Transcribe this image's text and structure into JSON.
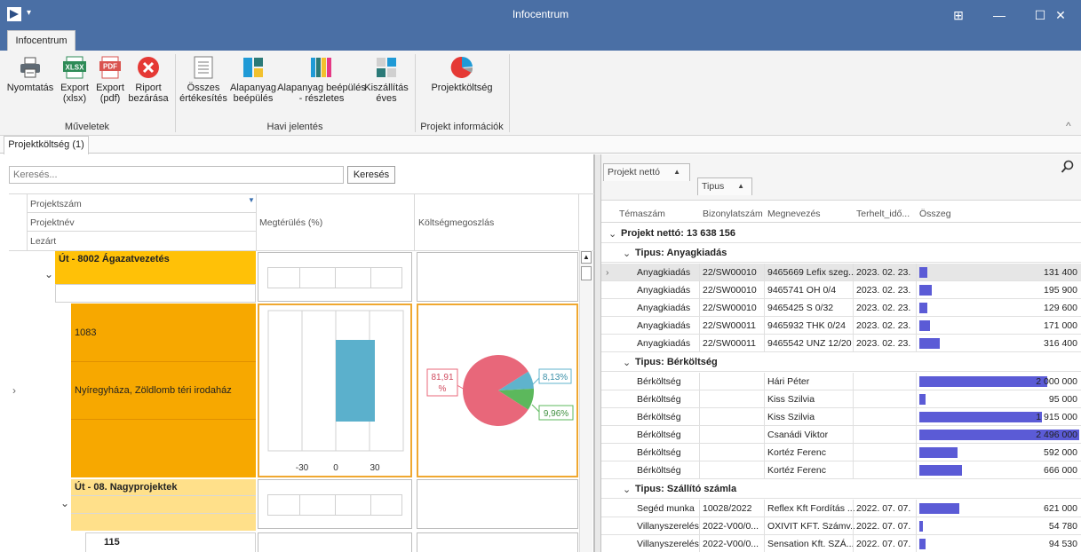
{
  "window": {
    "title": "Infocentrum",
    "menu_arrow": "▾",
    "minimize": "—",
    "maximize": "☐",
    "close": "✕",
    "layout_icon": "⊞"
  },
  "ribbon": {
    "tab": "Infocentrum",
    "buttons": {
      "print": "Nyomtatás",
      "export_xlsx_1": "Export",
      "export_xlsx_2": "(xlsx)",
      "export_pdf_1": "Export",
      "export_pdf_2": "(pdf)",
      "close_report_1": "Riport",
      "close_report_2": "bezárása",
      "all_sales_1": "Összes",
      "all_sales_2": "értékesítés",
      "material_1": "Alapanyag",
      "material_2": "beépülés",
      "material_detail_1": "Alapanyag beépülés",
      "material_detail_2": "- részletes",
      "delivery_1": "Kiszállítás",
      "delivery_2": "éves",
      "project_cost": "Projektköltség"
    },
    "xlsx_badge": "XLSX",
    "pdf_badge": "PDF",
    "groups": {
      "operations": "Műveletek",
      "monthly": "Havi jelentés",
      "project_info": "Projekt információk"
    },
    "collapse": "^"
  },
  "doc_tab": "Projektköltség (1)",
  "left": {
    "search_placeholder": "Keresés...",
    "search_button": "Keresés",
    "headers": {
      "project_no": "Projektszám",
      "project_name": "Projektnév",
      "closed": "Lezárt",
      "return": "Megtérülés (%)",
      "cost_dist": "Költségmegoszlás"
    },
    "rows": {
      "row1_title": "Út - 8002 Ágazatvezetés",
      "row1b_id": "1083",
      "row1b_name": "Nyíregyháza, Zöldlomb téri irodaház",
      "row2_title": "Út - 08. Nagyprojektek",
      "row2b_id": "115"
    },
    "expand": "⌄",
    "row_pointer": "›",
    "axis_ticks": [
      "-30",
      "0",
      "30"
    ],
    "return_bar": {
      "value": 30
    },
    "pie": {
      "slices": [
        {
          "label": "81,91 %",
          "value": 81.91,
          "color": "#e8677a"
        },
        {
          "label": "8,13%",
          "value": 8.13,
          "color": "#5fb3cc"
        },
        {
          "label": "9,96%",
          "value": 9.96,
          "color": "#5cb85c"
        }
      ]
    }
  },
  "right": {
    "group_chips": {
      "first": "Projekt nettó",
      "second": "Tipus"
    },
    "columns": {
      "topic": "Témaszám",
      "doc_no": "Bizonylatszám",
      "name": "Megnevezés",
      "date": "Terhelt_idő...",
      "amount": "Összeg"
    },
    "total_group": "Projekt nettó: 13 638 156",
    "groups": [
      {
        "title": "Tipus: Anyagkiadás",
        "rows": [
          {
            "topic": "Anyagkiadás",
            "doc": "22/SW00010",
            "name": "9465669 Lefix szeg...",
            "date": "2023. 02. 23.",
            "amount": "131 400",
            "value": 131400
          },
          {
            "topic": "Anyagkiadás",
            "doc": "22/SW00010",
            "name": "9465741 OH 0/4",
            "date": "2023. 02. 23.",
            "amount": "195 900",
            "value": 195900
          },
          {
            "topic": "Anyagkiadás",
            "doc": "22/SW00010",
            "name": "9465425 S 0/32",
            "date": "2023. 02. 23.",
            "amount": "129 600",
            "value": 129600
          },
          {
            "topic": "Anyagkiadás",
            "doc": "22/SW00011",
            "name": "9465932 THK 0/24",
            "date": "2023. 02. 23.",
            "amount": "171 000",
            "value": 171000
          },
          {
            "topic": "Anyagkiadás",
            "doc": "22/SW00011",
            "name": "9465542 UNZ 12/20",
            "date": "2023. 02. 23.",
            "amount": "316 400",
            "value": 316400
          }
        ]
      },
      {
        "title": "Tipus: Bérköltség",
        "rows": [
          {
            "topic": "Bérköltség",
            "doc": "",
            "name": "Hári Péter",
            "date": "",
            "amount": "2 000 000",
            "value": 2000000
          },
          {
            "topic": "Bérköltség",
            "doc": "",
            "name": "Kiss Szilvia",
            "date": "",
            "amount": "95 000",
            "value": 95000
          },
          {
            "topic": "Bérköltség",
            "doc": "",
            "name": "Kiss Szilvia",
            "date": "",
            "amount": "1 915 000",
            "value": 1915000
          },
          {
            "topic": "Bérköltség",
            "doc": "",
            "name": "Csanádi Viktor",
            "date": "",
            "amount": "2 496 000",
            "value": 2496000
          },
          {
            "topic": "Bérköltség",
            "doc": "",
            "name": "Kortéz Ferenc",
            "date": "",
            "amount": "592 000",
            "value": 592000
          },
          {
            "topic": "Bérköltség",
            "doc": "",
            "name": "Kortéz Ferenc",
            "date": "",
            "amount": "666 000",
            "value": 666000
          }
        ]
      },
      {
        "title": "Tipus: Szállító számla",
        "rows": [
          {
            "topic": "Segéd munka",
            "doc": "10028/2022",
            "name": "Reflex Kft Fordítás ...",
            "date": "2022. 07. 07.",
            "amount": "621 000",
            "value": 621000
          },
          {
            "topic": "Villanyszerelés",
            "doc": "2022-V00/0...",
            "name": "OXIVIT KFT. Számv...",
            "date": "2022. 07. 07.",
            "amount": "54 780",
            "value": 54780
          },
          {
            "topic": "Villanyszerelés",
            "doc": "2022-V00/0...",
            "name": "Sensation Kft. SZÁ...",
            "date": "2022. 07. 07.",
            "amount": "94 530",
            "value": 94530
          }
        ]
      }
    ],
    "bar_max_value": 2496000
  }
}
